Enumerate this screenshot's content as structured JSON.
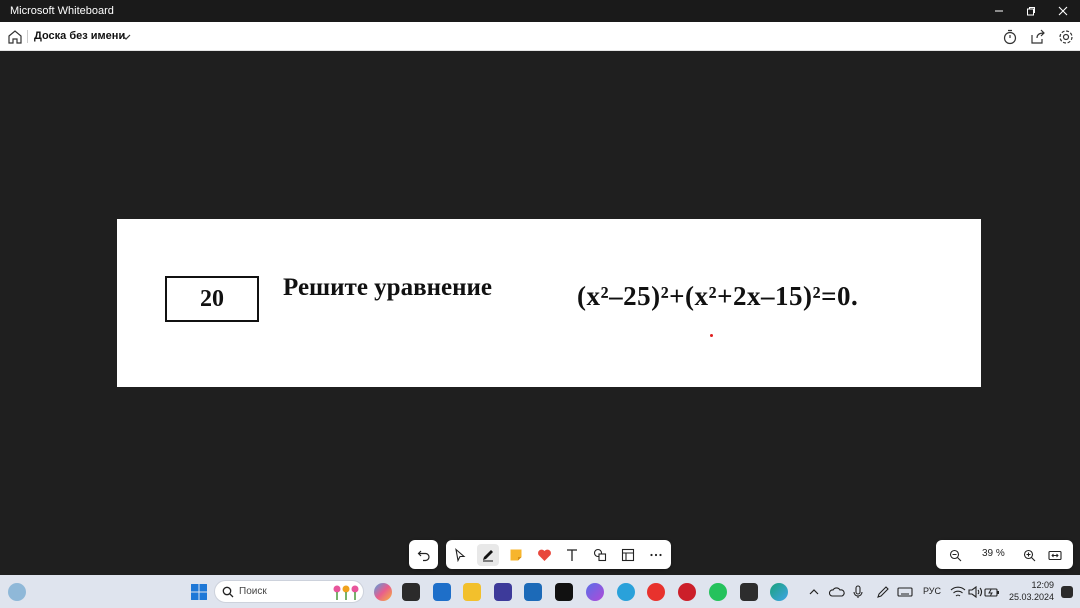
{
  "window": {
    "title": "Microsoft Whiteboard"
  },
  "appbar": {
    "board_name": "Доска без имени"
  },
  "problem": {
    "number": "20",
    "text": "Решите уравнение",
    "equation": "(x²–25)²+(x²+2x–15)²=0."
  },
  "zoom": {
    "value": "39 %"
  },
  "taskbar": {
    "search_placeholder": "Поиск",
    "lang": "РУС",
    "time": "12:09",
    "date": "25.03.2024"
  },
  "colors": {
    "canvas": "#1f1f1f",
    "accent": "#0078d4"
  }
}
